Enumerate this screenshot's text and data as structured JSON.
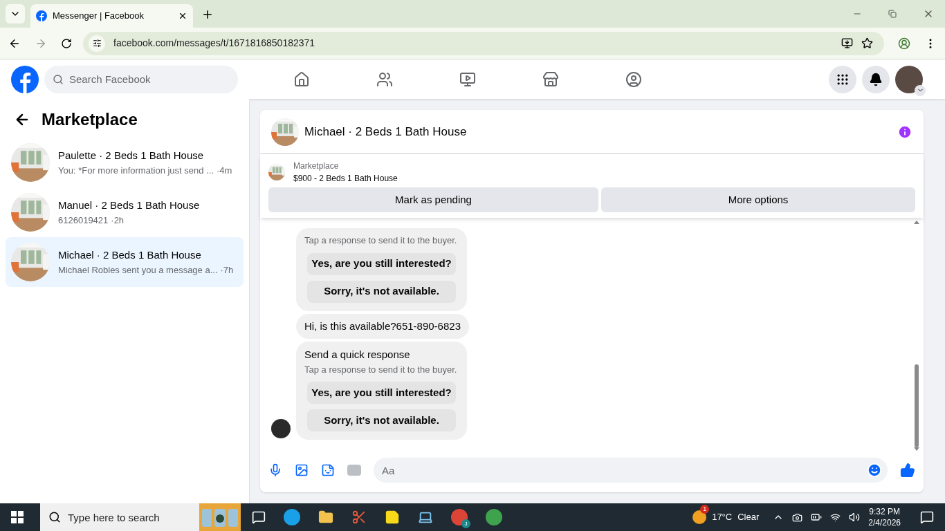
{
  "browser": {
    "tab_title": "Messenger | Facebook",
    "url": "facebook.com/messages/t/1671816850182371"
  },
  "header": {
    "search_placeholder": "Search Facebook"
  },
  "sidebar": {
    "title": "Marketplace",
    "conversations": [
      {
        "name": "Paulette · 2 Beds 1 Bath House",
        "preview": "You: *For more information just send ...",
        "time": "·4m",
        "selected": false
      },
      {
        "name": "Manuel · 2 Beds 1 Bath House",
        "preview": "6126019421",
        "time": "·2h",
        "selected": false
      },
      {
        "name": "Michael · 2 Beds 1 Bath House",
        "preview": "Michael Robles sent you a message a...",
        "time": "·7h",
        "selected": true
      }
    ]
  },
  "chat": {
    "title": "Michael · 2 Beds 1 Bath House",
    "listing": {
      "label": "Marketplace",
      "title": "$900 - 2 Beds 1 Bath House"
    },
    "actions": [
      "Mark as pending",
      "More options"
    ],
    "messages": [
      {
        "kind": "quick",
        "subtitle": "Tap a response to send it to the buyer.",
        "options": [
          "Yes, are you still interested?",
          "Sorry, it's not available."
        ]
      },
      {
        "kind": "text",
        "text": "Hi, is this available?651-890-6823"
      },
      {
        "kind": "quick",
        "title": "Send a quick response",
        "subtitle": "Tap a response to send it to the buyer.",
        "options": [
          "Yes, are you still interested?",
          "Sorry, it's not available."
        ]
      }
    ],
    "composer_placeholder": "Aa"
  },
  "taskbar": {
    "search_placeholder": "Type here to search",
    "weather_badge": "1",
    "temperature": "17°C",
    "condition": "Clear",
    "profile_badge": "J",
    "time": "9:32 PM",
    "date": "2/4/2026"
  }
}
